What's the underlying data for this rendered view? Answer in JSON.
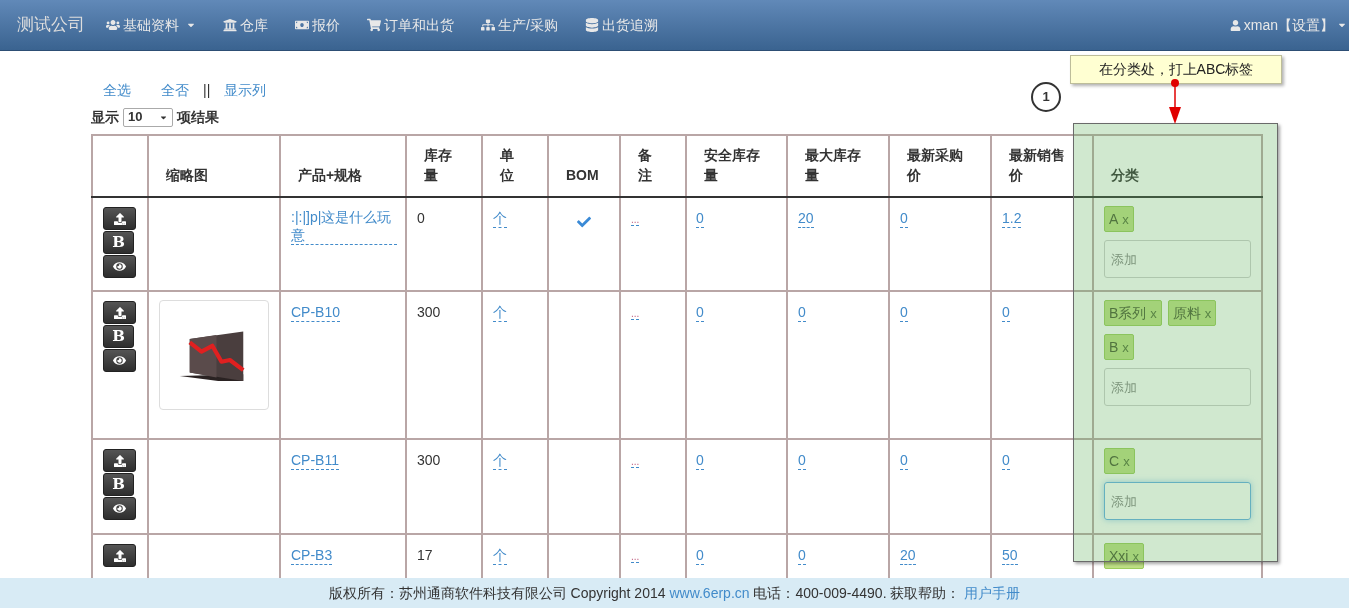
{
  "navbar": {
    "brand": "测试公司",
    "items": [
      {
        "label": "基础资料",
        "dropdown": true
      },
      {
        "label": "仓库",
        "dropdown": false
      },
      {
        "label": "报价",
        "dropdown": false
      },
      {
        "label": "订单和出货",
        "dropdown": false
      },
      {
        "label": "生产/采购",
        "dropdown": false
      },
      {
        "label": "出货追溯",
        "dropdown": false
      }
    ],
    "user": {
      "label": "xman【设置】",
      "dropdown": true
    }
  },
  "toolbar": {
    "links": [
      "全选",
      "全否",
      "显示列"
    ],
    "separator": "||"
  },
  "page_size": {
    "prefix": "显示",
    "value": "10",
    "suffix": "项结果"
  },
  "table": {
    "columns": [
      "缩略图",
      "产品+规格",
      "库存量",
      "单位",
      "BOM",
      "备注",
      "安全库存量",
      "最大库存量",
      "最新采购价",
      "最新销售价",
      "分类"
    ],
    "rows": [
      {
        "actions": [
          {
            "kind": "upload"
          },
          {
            "kind": "text",
            "label": "B"
          },
          {
            "kind": "view"
          }
        ],
        "thumbnail": null,
        "product": ":|:|]p|这是什么玩意",
        "stock": "0",
        "unit": "个",
        "bom": true,
        "note": "...",
        "safety_stock": "0",
        "max_stock": "20",
        "purchase_price": "0",
        "sale_price": "1.2",
        "tags": [
          {
            "label": "A",
            "remove": "x"
          }
        ],
        "add_field": {
          "placeholder": "添加",
          "focused": false
        }
      },
      {
        "actions": [
          {
            "kind": "upload"
          },
          {
            "kind": "text",
            "label": "B"
          },
          {
            "kind": "view"
          }
        ],
        "thumbnail": {
          "kind": "picture"
        },
        "product": "CP-B10",
        "stock": "300",
        "unit": "个",
        "bom": false,
        "note": "...",
        "safety_stock": "0",
        "max_stock": "0",
        "purchase_price": "0",
        "sale_price": "0",
        "tags": [
          {
            "label": "B系列",
            "remove": "x"
          },
          {
            "label": "原料",
            "remove": "x"
          },
          {
            "label": "B",
            "remove": "x"
          }
        ],
        "add_field": {
          "placeholder": "添加",
          "focused": false
        }
      },
      {
        "actions": [
          {
            "kind": "upload"
          },
          {
            "kind": "text",
            "label": "B"
          },
          {
            "kind": "view"
          }
        ],
        "thumbnail": null,
        "product": "CP-B11",
        "stock": "300",
        "unit": "个",
        "bom": false,
        "note": "...",
        "safety_stock": "0",
        "max_stock": "0",
        "purchase_price": "0",
        "sale_price": "0",
        "tags": [
          {
            "label": "C",
            "remove": "x"
          }
        ],
        "add_field": {
          "placeholder": "添加",
          "focused": true
        }
      },
      {
        "actions": [
          {
            "kind": "upload"
          }
        ],
        "thumbnail": null,
        "product": "CP-B3",
        "stock": "17",
        "unit": "个",
        "bom": false,
        "note": "...",
        "safety_stock": "0",
        "max_stock": "0",
        "purchase_price": "20",
        "sale_price": "50",
        "tags": [
          {
            "label": "Xxi",
            "remove": "x"
          }
        ]
      }
    ]
  },
  "annotation": {
    "number": "1",
    "text": "在分类处，打上ABC标签"
  },
  "footer": {
    "text_before": "版权所有：苏州通商软件科技有限公司 Copyright 2014",
    "site_link": "www.6erp.cn",
    "text_middle": "电话：400-009-4490. 获取帮助：",
    "help_link": "用户手册"
  }
}
